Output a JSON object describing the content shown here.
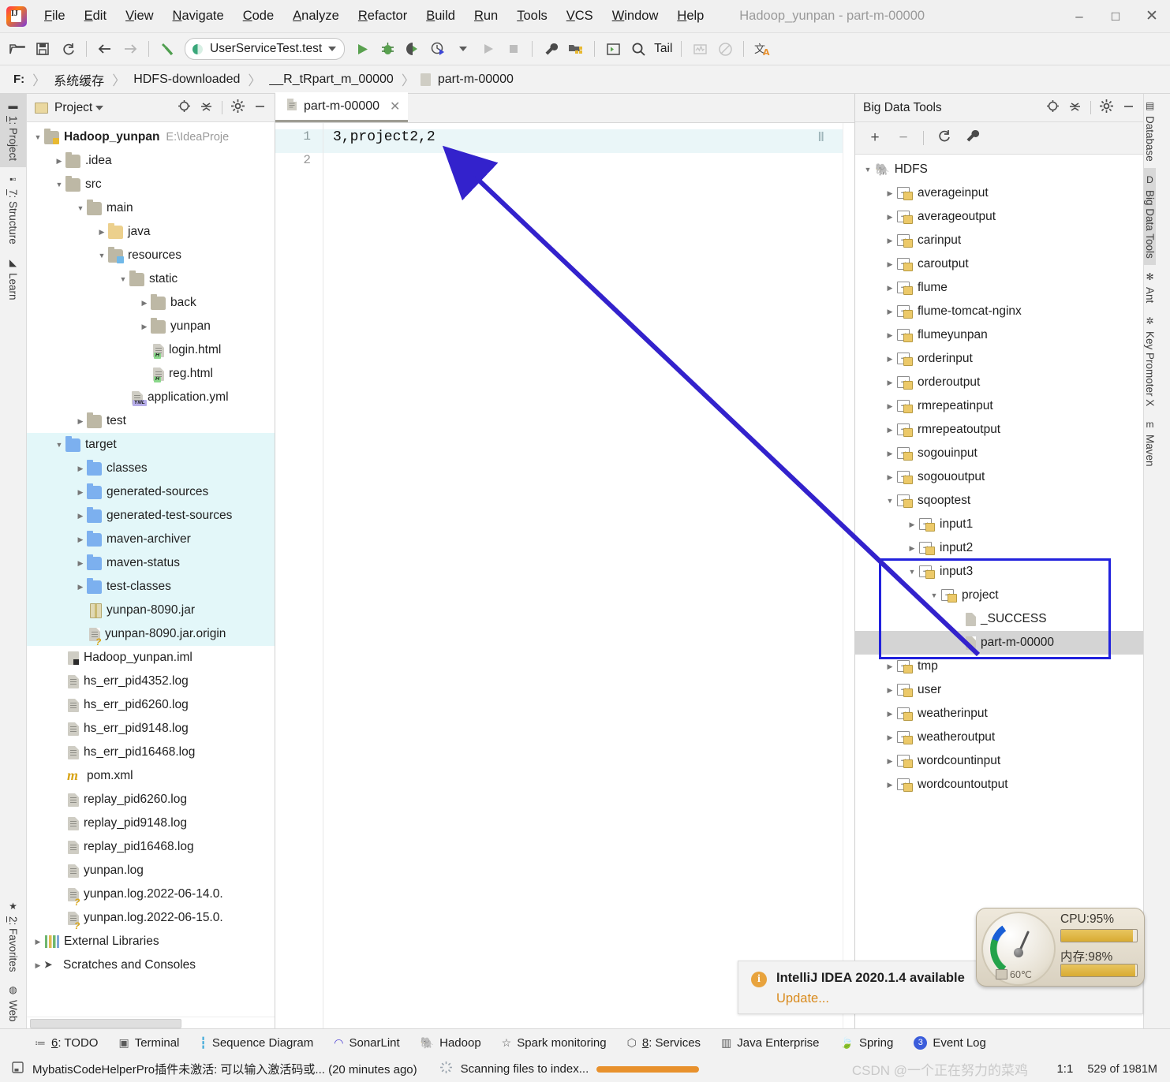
{
  "titlebar": {
    "menus": [
      "File",
      "Edit",
      "View",
      "Navigate",
      "Code",
      "Analyze",
      "Refactor",
      "Build",
      "Run",
      "Tools",
      "VCS",
      "Window",
      "Help"
    ],
    "window_title": "Hadoop_yunpan - part-m-00000",
    "minimize": "–",
    "maximize": "□",
    "close": "✕"
  },
  "toolbar": {
    "open_icon": "open-folder-icon",
    "save_icon": "save-icon",
    "sync_icon": "refresh-icon",
    "back_icon": "←",
    "forward_icon": "→",
    "build_icon": "hammer-icon",
    "run_config": "UserServiceTest.test",
    "run_icon": "▶",
    "debug_icon": "bug-icon",
    "coverage_icon": "run-with-coverage-icon",
    "profile_icon": "profiler-icon",
    "stop_icon": "■",
    "settings_icon": "wrench-icon",
    "project_structure_icon": "project-structure-icon",
    "terminal_icon": "console-icon",
    "search_icon": "⌕",
    "tail_label": "Tail",
    "chart_icon": "monitoring-icon",
    "disable_icon": "⊘",
    "translate_icon": "translate-icon"
  },
  "breadcrumb": {
    "drive": "F:",
    "items": [
      "系统缓存",
      "HDFS-downloaded",
      "__R_tRpart_m_00000",
      "part-m-00000"
    ],
    "separator": "〉"
  },
  "left_strip": {
    "tabs": [
      {
        "label": "1: Project",
        "icon": "project-icon",
        "selected": true
      },
      {
        "label": "7: Structure",
        "icon": "structure-icon",
        "selected": false
      },
      {
        "label": "Learn",
        "icon": "graduation-cap-icon",
        "selected": false
      },
      {
        "label": "2: Favorites",
        "icon": "star-icon",
        "selected": false
      },
      {
        "label": "Web",
        "icon": "globe-icon",
        "selected": false
      }
    ]
  },
  "right_strip": {
    "tabs": [
      {
        "label": "Database",
        "icon": "database-icon",
        "selected": false
      },
      {
        "label": "Big Data Tools",
        "icon": "big-data-tools-icon",
        "selected": true
      },
      {
        "label": "Ant",
        "icon": "ant-icon",
        "selected": false
      },
      {
        "label": "Key Promoter X",
        "icon": "key-promoter-icon",
        "selected": false
      },
      {
        "label": "Maven",
        "icon": "maven-icon",
        "selected": false
      }
    ]
  },
  "project_panel": {
    "title": "Project",
    "dropdown_icon": "chevron-down-icon",
    "locate_icon": "locate-file-icon",
    "collapse_icon": "collapse-all-icon",
    "settings_icon": "gear-icon",
    "hide_icon": "minimize-icon",
    "tree": [
      {
        "label": "Hadoop_yunpan",
        "path": "E:\\IdeaProje",
        "indent": 0,
        "twist": "▼",
        "icon": "module-folder",
        "bold": true
      },
      {
        "label": ".idea",
        "indent": 1,
        "twist": "▶",
        "icon": "folder"
      },
      {
        "label": "src",
        "indent": 1,
        "twist": "▼",
        "icon": "folder"
      },
      {
        "label": "main",
        "indent": 2,
        "twist": "▼",
        "icon": "folder"
      },
      {
        "label": "java",
        "indent": 3,
        "twist": "▶",
        "icon": "folder-yellow"
      },
      {
        "label": "resources",
        "indent": 3,
        "twist": "▼",
        "icon": "folder-resources"
      },
      {
        "label": "static",
        "indent": 4,
        "twist": "▼",
        "icon": "folder"
      },
      {
        "label": "back",
        "indent": 5,
        "twist": "▶",
        "icon": "folder"
      },
      {
        "label": "yunpan",
        "indent": 5,
        "twist": "▶",
        "icon": "folder"
      },
      {
        "label": "login.html",
        "indent": 5,
        "twist": "",
        "icon": "file-html"
      },
      {
        "label": "reg.html",
        "indent": 5,
        "twist": "",
        "icon": "file-html"
      },
      {
        "label": "application.yml",
        "indent": 4,
        "twist": "",
        "icon": "file-yml"
      },
      {
        "label": "test",
        "indent": 2,
        "twist": "▶",
        "icon": "folder"
      },
      {
        "label": "target",
        "indent": 1,
        "twist": "▼",
        "icon": "folder-blue",
        "highlight": true
      },
      {
        "label": "classes",
        "indent": 2,
        "twist": "▶",
        "icon": "folder-blue",
        "highlight": true
      },
      {
        "label": "generated-sources",
        "indent": 2,
        "twist": "▶",
        "icon": "folder-blue",
        "highlight": true
      },
      {
        "label": "generated-test-sources",
        "indent": 2,
        "twist": "▶",
        "icon": "folder-blue",
        "highlight": true
      },
      {
        "label": "maven-archiver",
        "indent": 2,
        "twist": "▶",
        "icon": "folder-blue",
        "highlight": true
      },
      {
        "label": "maven-status",
        "indent": 2,
        "twist": "▶",
        "icon": "folder-blue",
        "highlight": true
      },
      {
        "label": "test-classes",
        "indent": 2,
        "twist": "▶",
        "icon": "folder-blue",
        "highlight": true
      },
      {
        "label": "yunpan-8090.jar",
        "indent": 2,
        "twist": "",
        "icon": "file-jar",
        "highlight": true
      },
      {
        "label": "yunpan-8090.jar.origin",
        "indent": 2,
        "twist": "",
        "icon": "file-unknown",
        "highlight": true
      },
      {
        "label": "Hadoop_yunpan.iml",
        "indent": 1,
        "twist": "",
        "icon": "file-iml"
      },
      {
        "label": "hs_err_pid4352.log",
        "indent": 1,
        "twist": "",
        "icon": "file-text"
      },
      {
        "label": "hs_err_pid6260.log",
        "indent": 1,
        "twist": "",
        "icon": "file-text"
      },
      {
        "label": "hs_err_pid9148.log",
        "indent": 1,
        "twist": "",
        "icon": "file-text"
      },
      {
        "label": "hs_err_pid16468.log",
        "indent": 1,
        "twist": "",
        "icon": "file-text"
      },
      {
        "label": "pom.xml",
        "indent": 1,
        "twist": "",
        "icon": "file-maven"
      },
      {
        "label": "replay_pid6260.log",
        "indent": 1,
        "twist": "",
        "icon": "file-text"
      },
      {
        "label": "replay_pid9148.log",
        "indent": 1,
        "twist": "",
        "icon": "file-text"
      },
      {
        "label": "replay_pid16468.log",
        "indent": 1,
        "twist": "",
        "icon": "file-text"
      },
      {
        "label": "yunpan.log",
        "indent": 1,
        "twist": "",
        "icon": "file-text"
      },
      {
        "label": "yunpan.log.2022-06-14.0.",
        "indent": 1,
        "twist": "",
        "icon": "file-unknown"
      },
      {
        "label": "yunpan.log.2022-06-15.0.",
        "indent": 1,
        "twist": "",
        "icon": "file-unknown"
      },
      {
        "label": "External Libraries",
        "indent": 0,
        "twist": "▶",
        "icon": "libraries"
      },
      {
        "label": "Scratches and Consoles",
        "indent": 0,
        "twist": "▶",
        "icon": "scratches"
      }
    ]
  },
  "editor": {
    "tab_label": "part-m-00000",
    "tab_icon": "text-file-icon",
    "close_icon": "✕",
    "line_numbers": [
      "1",
      "2"
    ],
    "lines": [
      "3,project2,2",
      ""
    ],
    "pause_marker": "‖"
  },
  "bdt_panel": {
    "title": "Big Data Tools",
    "locate_icon": "locate-icon",
    "collapse_icon": "collapse-all-icon",
    "settings_icon": "gear-icon",
    "hide_icon": "minimize-icon",
    "add_icon": "+",
    "remove_icon": "−",
    "refresh_icon": "refresh-icon",
    "config_icon": "wrench-icon",
    "tree": [
      {
        "label": "HDFS",
        "indent": 0,
        "twist": "▼",
        "icon": "hadoop-elephant"
      },
      {
        "label": "averageinput",
        "indent": 1,
        "twist": "▶",
        "icon": "hdfs-folder"
      },
      {
        "label": "averageoutput",
        "indent": 1,
        "twist": "▶",
        "icon": "hdfs-folder"
      },
      {
        "label": "carinput",
        "indent": 1,
        "twist": "▶",
        "icon": "hdfs-folder"
      },
      {
        "label": "caroutput",
        "indent": 1,
        "twist": "▶",
        "icon": "hdfs-folder"
      },
      {
        "label": "flume",
        "indent": 1,
        "twist": "▶",
        "icon": "hdfs-folder"
      },
      {
        "label": "flume-tomcat-nginx",
        "indent": 1,
        "twist": "▶",
        "icon": "hdfs-folder"
      },
      {
        "label": "flumeyunpan",
        "indent": 1,
        "twist": "▶",
        "icon": "hdfs-folder"
      },
      {
        "label": "orderinput",
        "indent": 1,
        "twist": "▶",
        "icon": "hdfs-folder"
      },
      {
        "label": "orderoutput",
        "indent": 1,
        "twist": "▶",
        "icon": "hdfs-folder"
      },
      {
        "label": "rmrepeatinput",
        "indent": 1,
        "twist": "▶",
        "icon": "hdfs-folder"
      },
      {
        "label": "rmrepeatoutput",
        "indent": 1,
        "twist": "▶",
        "icon": "hdfs-folder"
      },
      {
        "label": "sogouinput",
        "indent": 1,
        "twist": "▶",
        "icon": "hdfs-folder"
      },
      {
        "label": "sogououtput",
        "indent": 1,
        "twist": "▶",
        "icon": "hdfs-folder"
      },
      {
        "label": "sqooptest",
        "indent": 1,
        "twist": "▼",
        "icon": "hdfs-folder"
      },
      {
        "label": "input1",
        "indent": 2,
        "twist": "▶",
        "icon": "hdfs-folder"
      },
      {
        "label": "input2",
        "indent": 2,
        "twist": "▶",
        "icon": "hdfs-folder"
      },
      {
        "label": "input3",
        "indent": 2,
        "twist": "▼",
        "icon": "hdfs-folder"
      },
      {
        "label": "project",
        "indent": 3,
        "twist": "▼",
        "icon": "hdfs-folder"
      },
      {
        "label": "_SUCCESS",
        "indent": 4,
        "twist": "",
        "icon": "hdfs-file"
      },
      {
        "label": "part-m-00000",
        "indent": 4,
        "twist": "",
        "icon": "hdfs-file",
        "selected": true
      },
      {
        "label": "tmp",
        "indent": 1,
        "twist": "▶",
        "icon": "hdfs-folder"
      },
      {
        "label": "user",
        "indent": 1,
        "twist": "▶",
        "icon": "hdfs-folder"
      },
      {
        "label": "weatherinput",
        "indent": 1,
        "twist": "▶",
        "icon": "hdfs-folder"
      },
      {
        "label": "weatheroutput",
        "indent": 1,
        "twist": "▶",
        "icon": "hdfs-folder"
      },
      {
        "label": "wordcountinput",
        "indent": 1,
        "twist": "▶",
        "icon": "hdfs-folder"
      },
      {
        "label": "wordcountoutput",
        "indent": 1,
        "twist": "▶",
        "icon": "hdfs-folder"
      }
    ],
    "highlight_color": "#2222dd"
  },
  "bottom_bar": {
    "tabs": [
      {
        "label": "6: TODO",
        "icon": "todo-icon"
      },
      {
        "label": "Terminal",
        "icon": "terminal-icon"
      },
      {
        "label": "Sequence Diagram",
        "icon": "sequence-diagram-icon"
      },
      {
        "label": "SonarLint",
        "icon": "sonarlint-icon"
      },
      {
        "label": "Hadoop",
        "icon": "hadoop-icon"
      },
      {
        "label": "Spark monitoring",
        "icon": "star-icon"
      },
      {
        "label": "8: Services",
        "icon": "services-icon"
      },
      {
        "label": "Java Enterprise",
        "icon": "java-enterprise-icon"
      },
      {
        "label": "Spring",
        "icon": "spring-leaf-icon"
      },
      {
        "label": "Event Log",
        "icon": "event-log-icon",
        "badge": "3"
      }
    ]
  },
  "statusbar": {
    "message_icon": "notification-icon",
    "message": "MybatisCodeHelperPro插件未激活: 可以输入激活码或... (20 minutes ago)",
    "progress_icon": "spinner-icon",
    "progress_text": "Scanning files to index...",
    "progress_percent": 100,
    "caret_position": "1:1",
    "memory": "529 of 1981M",
    "watermark": "CSDN @一个正在努力的菜鸡"
  },
  "notification": {
    "icon": "info-icon",
    "title": "IntelliJ IDEA 2020.1.4 available",
    "action": "Update..."
  },
  "cpu_widget": {
    "cpu_label": "CPU:95%",
    "cpu_percent": 95,
    "mem_label": "内存:98%",
    "mem_percent": 98,
    "temp_label": "60℃"
  }
}
